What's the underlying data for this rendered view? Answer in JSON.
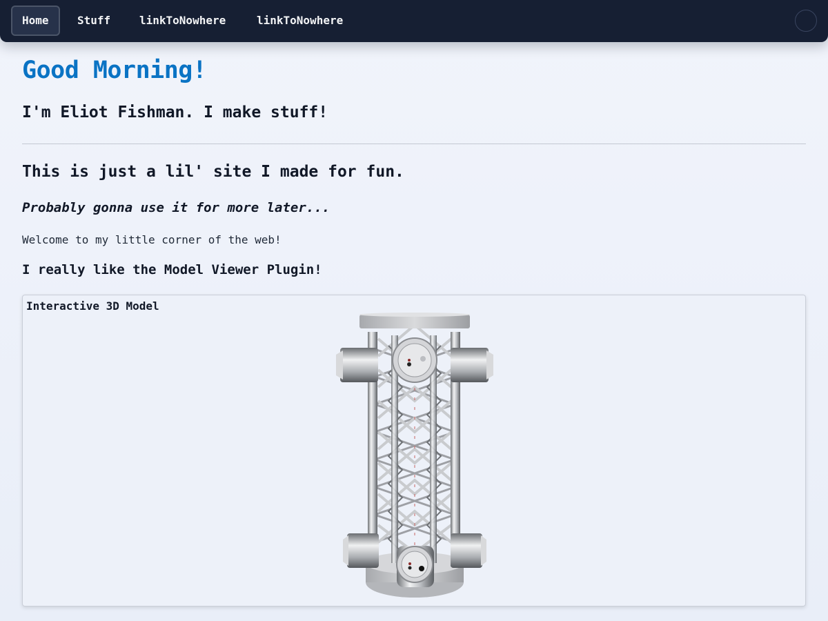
{
  "nav": {
    "items": [
      {
        "label": "Home",
        "active": true
      },
      {
        "label": "Stuff",
        "active": false
      },
      {
        "label": "linkToNowhere",
        "active": false
      },
      {
        "label": "linkToNowhere",
        "active": false
      }
    ]
  },
  "main": {
    "greeting": "Good Morning!",
    "intro": "I'm Eliot Fishman. I make stuff!",
    "heading": "This is just a lil' site I made for fun.",
    "italic_note": "Probably gonna use it for more later...",
    "welcome": "Welcome to my little corner of the web!",
    "model_heading": "I really like the Model Viewer Plugin!"
  },
  "viewer": {
    "label": "Interactive 3D Model"
  },
  "colors": {
    "nav_bg": "#161f33",
    "title_accent": "#0a73c4",
    "page_bg": "#eef2fa"
  }
}
